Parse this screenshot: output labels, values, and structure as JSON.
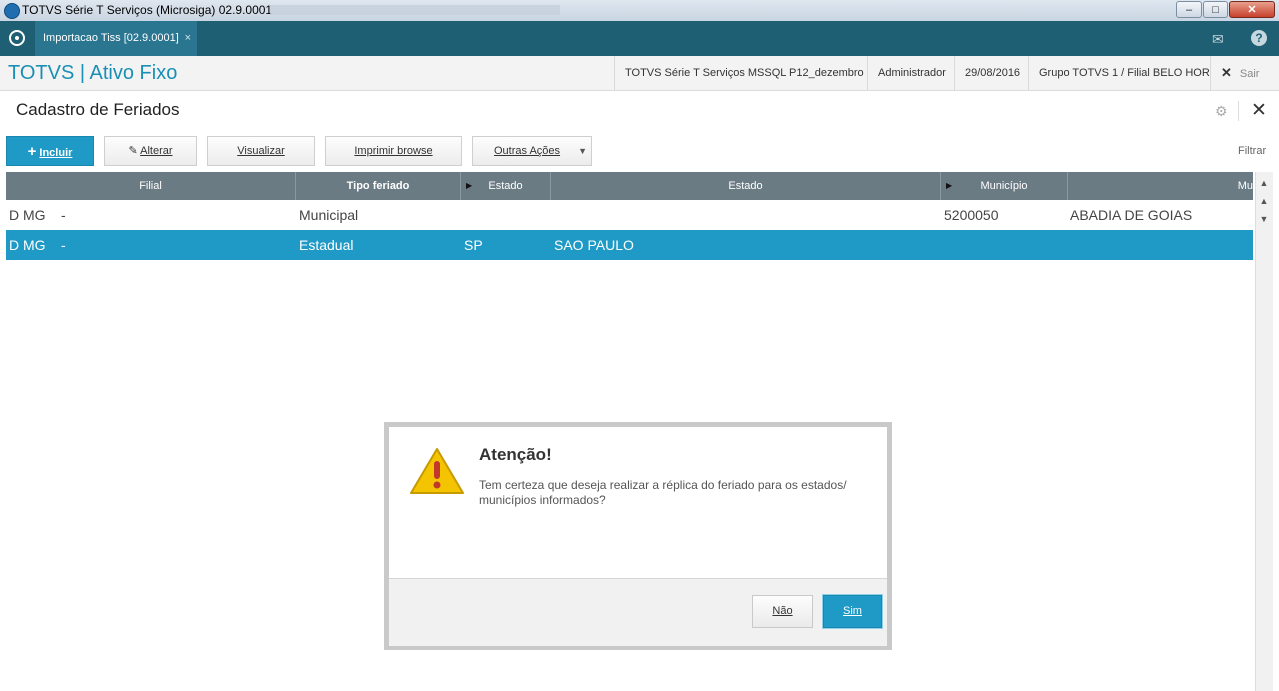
{
  "window": {
    "title": "TOTVS Série T Serviços (Microsiga) 02.9.0001",
    "min": "–",
    "max": "□",
    "close": "✕"
  },
  "tab": {
    "label": "Importacao Tiss [02.9.0001]",
    "close": "×"
  },
  "header": {
    "brand": "TOTVS | Ativo Fixo",
    "environment": "TOTVS Série T Serviços MSSQL P12_dezembro",
    "user": "Administrador",
    "date": "29/08/2016",
    "company": "Grupo TOTVS 1 / Filial BELO HOR",
    "exit": "Sair"
  },
  "page": {
    "title": "Cadastro de Feriados"
  },
  "toolbar": {
    "incluir": "Incluir",
    "alterar": "Alterar",
    "visualizar": "Visualizar",
    "imprimir": "Imprimir browse",
    "outras": "Outras Ações",
    "filtrar": "Filtrar"
  },
  "grid": {
    "columns": [
      "Filial",
      "Tipo feriado",
      "Estado",
      "Estado",
      "Município",
      "Mu"
    ],
    "rows": [
      {
        "filial": "D MG",
        "sep": "-",
        "tipo": "Municipal",
        "uf": "",
        "estado": "",
        "cod_mun": "5200050",
        "municipio": "ABADIA DE GOIAS",
        "selected": false
      },
      {
        "filial": "D MG",
        "sep": "-",
        "tipo": "Estadual",
        "uf": "SP",
        "estado": "SAO PAULO",
        "cod_mun": "",
        "municipio": "",
        "selected": true
      }
    ]
  },
  "dialog": {
    "title": "Atenção!",
    "message": "Tem certeza que deseja realizar a réplica do feriado para os estados/ municípios informados?",
    "no": "Não",
    "yes": "Sim"
  },
  "colors": {
    "accent": "#1f9ac6",
    "topbar": "#1f5f73",
    "grid_header": "#6b7b84",
    "warning": "#f5c400"
  }
}
